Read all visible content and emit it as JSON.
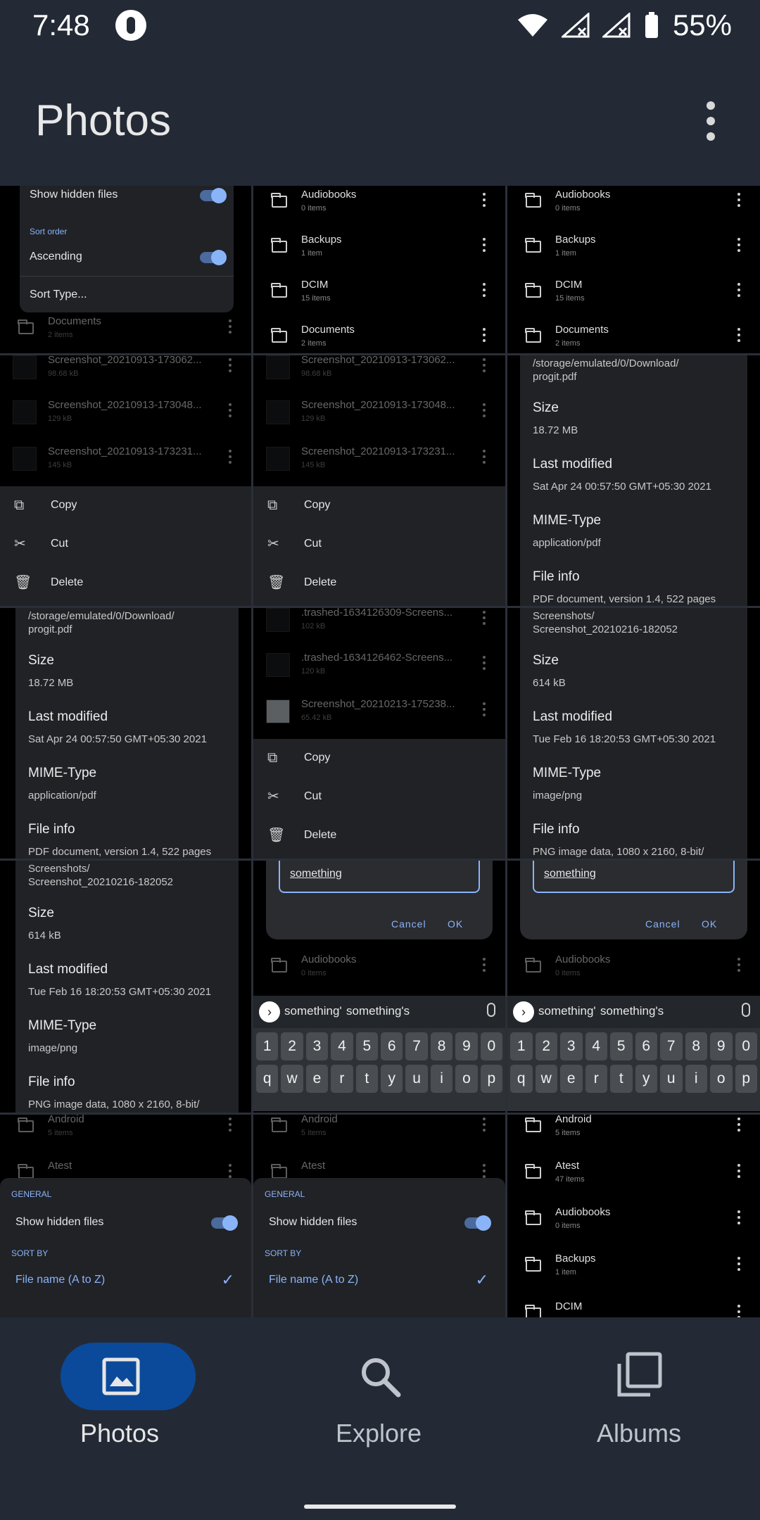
{
  "status": {
    "time": "7:48",
    "battery": "55%"
  },
  "header": {
    "title": "Photos"
  },
  "folders": {
    "audiobooks": {
      "name": "Audiobooks",
      "count": "0 items"
    },
    "backups": {
      "name": "Backups",
      "count": "1 item"
    },
    "dcim": {
      "name": "DCIM",
      "count": "15 items"
    },
    "documents": {
      "name": "Documents",
      "count": "2 items"
    },
    "android": {
      "name": "Android",
      "count": "5 items"
    },
    "atest": {
      "name": "Atest",
      "count": "47 items"
    }
  },
  "settings": {
    "show_hidden": "Show hidden files",
    "sort_order": "Sort order",
    "ascending": "Ascending",
    "sort_type": "Sort Type...",
    "general": "GENERAL",
    "sort_by": "SORT BY",
    "file_name_az": "File name (A to Z)"
  },
  "files": {
    "s1": {
      "name": "Screenshot_20210913-173062...",
      "size": "98.68 kB"
    },
    "s2": {
      "name": "Screenshot_20210913-173048...",
      "size": "129 kB"
    },
    "s3": {
      "name": "Screenshot_20210913-173231...",
      "size": "145 kB"
    },
    "t1": {
      "name": ".trashed-1634126309-Screens...",
      "size": "102 kB"
    },
    "t2": {
      "name": ".trashed-1634126462-Screens...",
      "size": "120 kB"
    },
    "t3": {
      "name": "Screenshot_20210213-175238...",
      "size": "65.42 kB"
    }
  },
  "context_menu": {
    "copy": "Copy",
    "cut": "Cut",
    "delete": "Delete"
  },
  "pdf_info": {
    "path": "/storage/emulated/0/Download/\nprogit.pdf",
    "size_label": "Size",
    "size": "18.72 MB",
    "modified_label": "Last modified",
    "modified": "Sat Apr 24 00:57:50 GMT+05:30 2021",
    "mime_label": "MIME-Type",
    "mime": "application/pdf",
    "fileinfo_label": "File info",
    "fileinfo": "PDF document, version 1.4, 522 pages"
  },
  "png_info": {
    "path": "Screenshots/\nScreenshot_20210216-182052",
    "size_label": "Size",
    "size": "614 kB",
    "modified_label": "Last modified",
    "modified": "Tue Feb 16 18:20:53 GMT+05:30 2021",
    "mime_label": "MIME-Type",
    "mime": "image/png",
    "fileinfo_label": "File info",
    "fileinfo": "PNG image data, 1080 x 2160, 8-bit/"
  },
  "rename_dialog": {
    "value": "something",
    "cancel": "Cancel",
    "ok": "OK"
  },
  "keyboard": {
    "suggest1": "something'",
    "suggest2": "something's",
    "numbers": [
      "1",
      "2",
      "3",
      "4",
      "5",
      "6",
      "7",
      "8",
      "9",
      "0"
    ],
    "letters": [
      "q",
      "w",
      "e",
      "r",
      "t",
      "y",
      "u",
      "i",
      "o",
      "p"
    ]
  },
  "nav": {
    "photos": "Photos",
    "explore": "Explore",
    "albums": "Albums"
  },
  "colors": {
    "accent": "#8ab4f8",
    "active_pill": "#0b4a9a",
    "background": "#232a36"
  }
}
